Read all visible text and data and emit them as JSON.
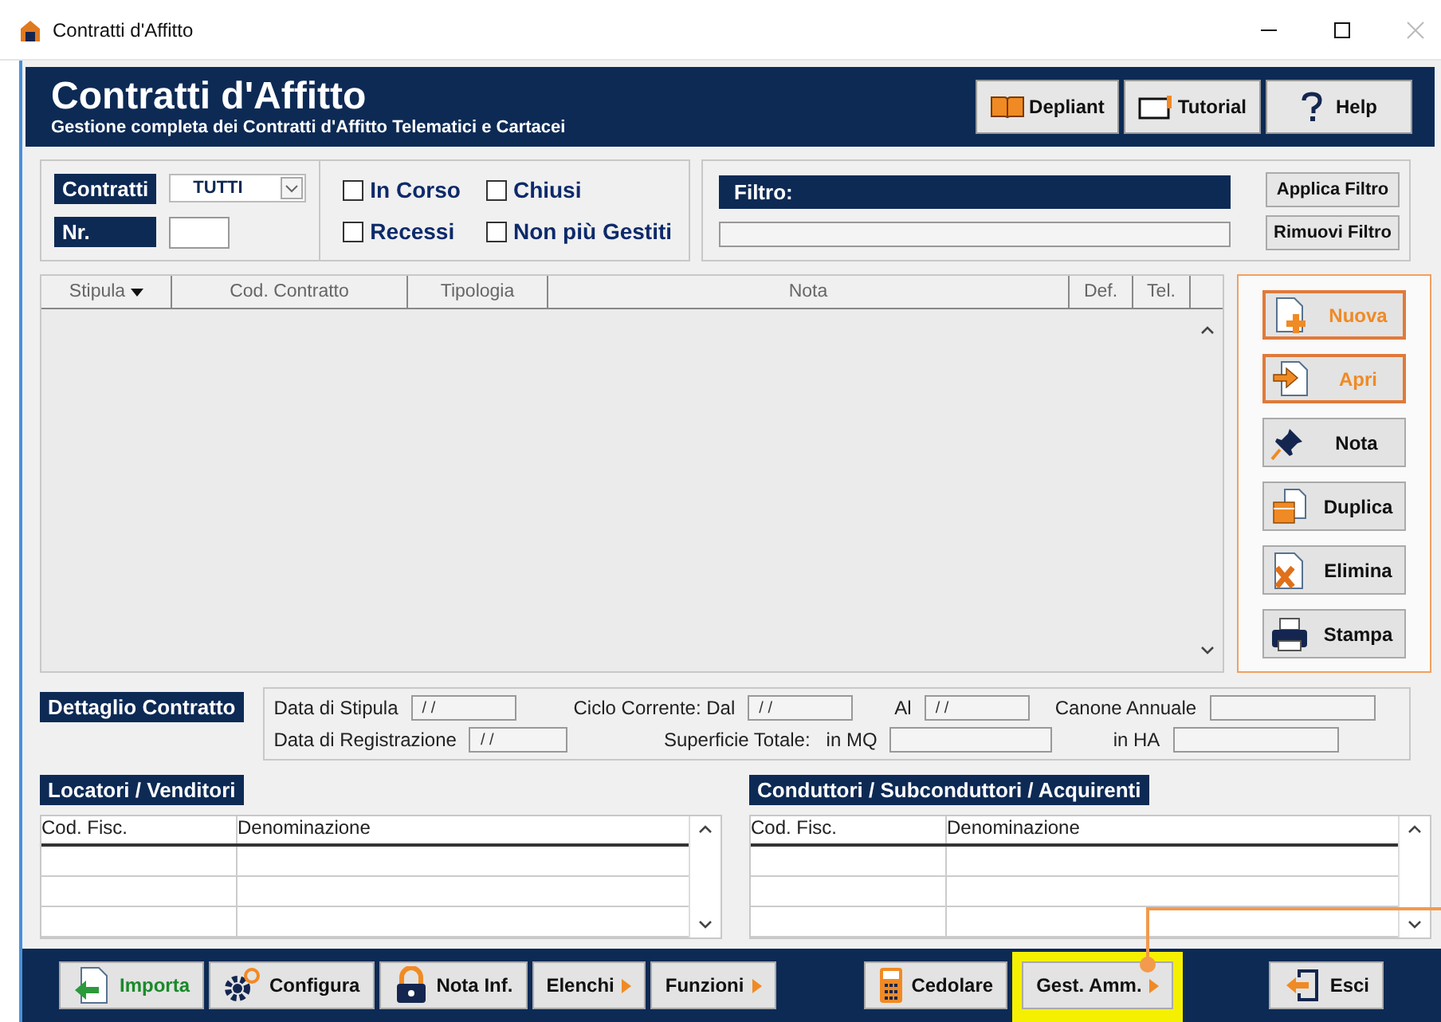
{
  "window": {
    "title": "Contratti d'Affitto"
  },
  "header": {
    "title": "Contratti d'Affitto",
    "subtitle": "Gestione completa dei Contratti d'Affitto Telematici e Cartacei",
    "buttons": [
      {
        "label": "Depliant"
      },
      {
        "label": "Tutorial"
      },
      {
        "label": "Help"
      }
    ]
  },
  "selection": {
    "contratti_label": "Contratti",
    "contratti_value": "TUTTI",
    "nr_label": "Nr.",
    "checkboxes": [
      {
        "label": "In Corso",
        "checked": false
      },
      {
        "label": "Chiusi",
        "checked": false
      },
      {
        "label": "Recessi",
        "checked": false
      },
      {
        "label": "Non più Gestiti",
        "checked": false
      }
    ]
  },
  "filter": {
    "label": "Filtro:",
    "buttons": [
      "Applica Filtro",
      "Rimuovi Filtro"
    ]
  },
  "table": {
    "columns": [
      {
        "label": "Stipula",
        "sorted": true
      },
      {
        "label": "Cod. Contratto",
        "sorted": false
      },
      {
        "label": "Tipologia",
        "sorted": false
      },
      {
        "label": "Nota",
        "sorted": false
      },
      {
        "label": "Def.",
        "sorted": false
      },
      {
        "label": "Tel.",
        "sorted": false
      }
    ]
  },
  "actions": [
    {
      "label": "Nuova",
      "highlighted": true
    },
    {
      "label": "Apri",
      "highlighted": true
    },
    {
      "label": "Nota",
      "highlighted": false
    },
    {
      "label": "Duplica",
      "highlighted": false
    },
    {
      "label": "Elimina",
      "highlighted": false
    },
    {
      "label": "Stampa",
      "highlighted": false
    }
  ],
  "detail": {
    "title": "Dettaglio Contratto",
    "rows": [
      [
        {
          "kind": "field",
          "label": "Data di Stipula",
          "value": "/ /"
        },
        {
          "kind": "field",
          "label": "Ciclo Corrente: Dal",
          "value": "/ /"
        },
        {
          "kind": "field",
          "label": "Al",
          "value": "/ /"
        },
        {
          "kind": "field",
          "label": "Canone Annuale"
        }
      ],
      [
        {
          "kind": "field",
          "label": "Data di Registrazione",
          "value": "/ /"
        },
        {
          "kind": "text",
          "label": "Superficie Totale:"
        },
        {
          "kind": "field",
          "label": "in MQ"
        },
        {
          "kind": "field",
          "label": "in HA"
        }
      ]
    ]
  },
  "parties": [
    {
      "title": "Locatori / Venditori",
      "columns": [
        "Cod. Fisc.",
        "Denominazione"
      ]
    },
    {
      "title": "Conduttori / Subconduttori / Acquirenti",
      "columns": [
        "Cod. Fisc.",
        "Denominazione"
      ]
    }
  ],
  "footer": {
    "buttons": [
      {
        "label": "Importa",
        "kind": "plain",
        "highlighted": false
      },
      {
        "label": "Configura",
        "kind": "plain",
        "highlighted": false
      },
      {
        "label": "Nota Inf.",
        "kind": "plain",
        "highlighted": false
      },
      {
        "label": "Elenchi",
        "kind": "menu",
        "highlighted": false
      },
      {
        "label": "Funzioni",
        "kind": "menu",
        "highlighted": false
      },
      {
        "label": "Cedolare",
        "kind": "plain",
        "highlighted": false
      },
      {
        "label": "Gest. Amm.",
        "kind": "menu",
        "highlighted": true
      },
      {
        "label": "Esci",
        "kind": "plain",
        "highlighted": false
      }
    ]
  }
}
